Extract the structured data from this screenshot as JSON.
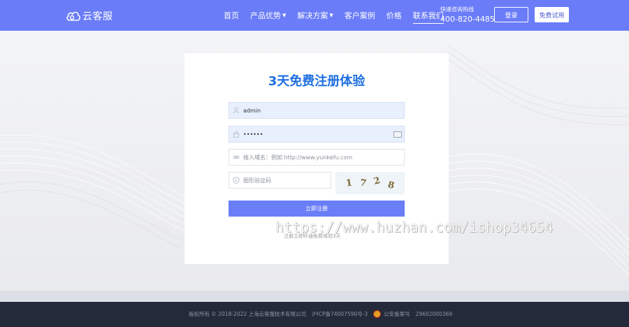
{
  "header": {
    "logo_text": "云客服",
    "nav": [
      {
        "label": "首页",
        "dropdown": false,
        "active": false
      },
      {
        "label": "产品优势",
        "dropdown": true,
        "active": false
      },
      {
        "label": "解决方案",
        "dropdown": true,
        "active": false
      },
      {
        "label": "客户案例",
        "dropdown": false,
        "active": false
      },
      {
        "label": "价格",
        "dropdown": false,
        "active": false
      },
      {
        "label": "联系我们",
        "dropdown": false,
        "active": true
      }
    ],
    "hotline_label": "快速咨询热线",
    "hotline_number": "400-820-4485",
    "login_label": "登录",
    "trial_label": "免费试用",
    "accent_color": "#6a7cf7"
  },
  "form": {
    "title": "3天免费注册体验",
    "username_value": "admin",
    "password_value": "••••••",
    "domain_placeholder": "接入域名：例如 http://www.yunkefu.com",
    "captcha_placeholder": "图形验证码",
    "captcha_chars": [
      "1",
      "7",
      "2",
      "8"
    ],
    "submit_label": "立即注册",
    "note": "注册立即开通免费体验3天",
    "icons": {
      "username": "user-icon",
      "password": "lock-icon",
      "domain": "link-icon",
      "captcha": "shield-icon"
    }
  },
  "watermark": "https://www.huzhan.com/ishop34654",
  "footer": {
    "copyright": "版权所有 © 2018-2022 上海云客服技术有限公司",
    "icp": "沪ICP备74007590号-3",
    "police_label": "公安备案号",
    "police_number": "29602000369"
  }
}
